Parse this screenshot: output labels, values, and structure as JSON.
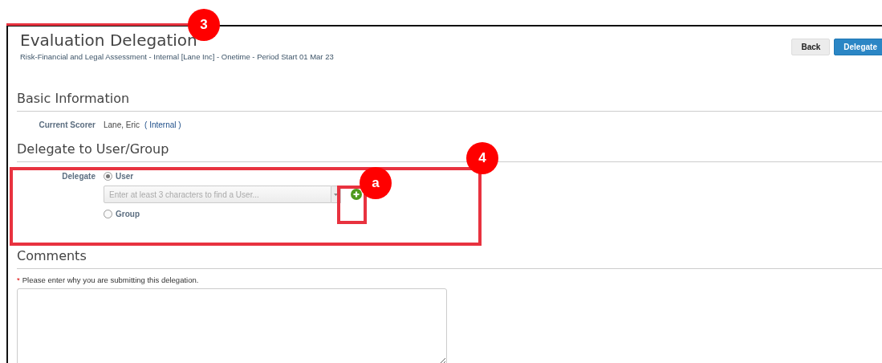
{
  "header": {
    "title": "Evaluation Delegation",
    "subtitle": "Risk-Financial and Legal Assessment - Internal [Lane Inc] - Onetime - Period Start 01 Mar 23"
  },
  "buttons": [
    {
      "label": "Back",
      "kind": "secondary"
    },
    {
      "label": "Delegate",
      "kind": "primary"
    }
  ],
  "basic_information": {
    "heading": "Basic Information",
    "label": "Current Scorer",
    "name": "Lane, Eric",
    "type": "( Internal )"
  },
  "delegate_section": {
    "heading": "Delegate to User/Group",
    "label": "Delegate",
    "options": [
      {
        "label": "User",
        "selected": true
      },
      {
        "label": "Group",
        "selected": false
      }
    ],
    "user_field": {
      "placeholder": "Enter at least 3 characters to find a User..."
    }
  },
  "comments": {
    "heading": "Comments",
    "required_mark": "*",
    "prompt": "Please enter why you are submitting this delegation."
  },
  "callouts": [
    {
      "label": "3",
      "kind": "circle"
    },
    {
      "label": "4",
      "kind": "box"
    },
    {
      "label": "a",
      "kind": "box"
    }
  ]
}
